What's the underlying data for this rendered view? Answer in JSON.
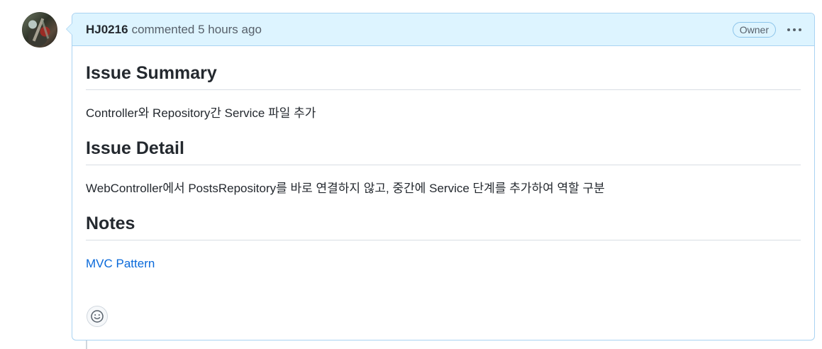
{
  "comment": {
    "author": "HJ0216",
    "action_text": "commented 5 hours ago",
    "badge": "Owner",
    "more_icon": "kebab-horizontal-icon",
    "reaction_icon": "smiley-icon"
  },
  "body": {
    "sections": [
      {
        "heading": "Issue Summary",
        "text": "Controller와 Repository간 Service 파일 추가"
      },
      {
        "heading": "Issue Detail",
        "text": "WebController에서 PostsRepository를 바로 연결하지 않고, 중간에 Service 단계를 추가하여 역할 구분"
      },
      {
        "heading": "Notes",
        "link_text": "MVC Pattern"
      }
    ]
  },
  "colors": {
    "header_bg": "#ddf4ff",
    "header_border": "#a9d3f2",
    "link": "#0969da"
  }
}
